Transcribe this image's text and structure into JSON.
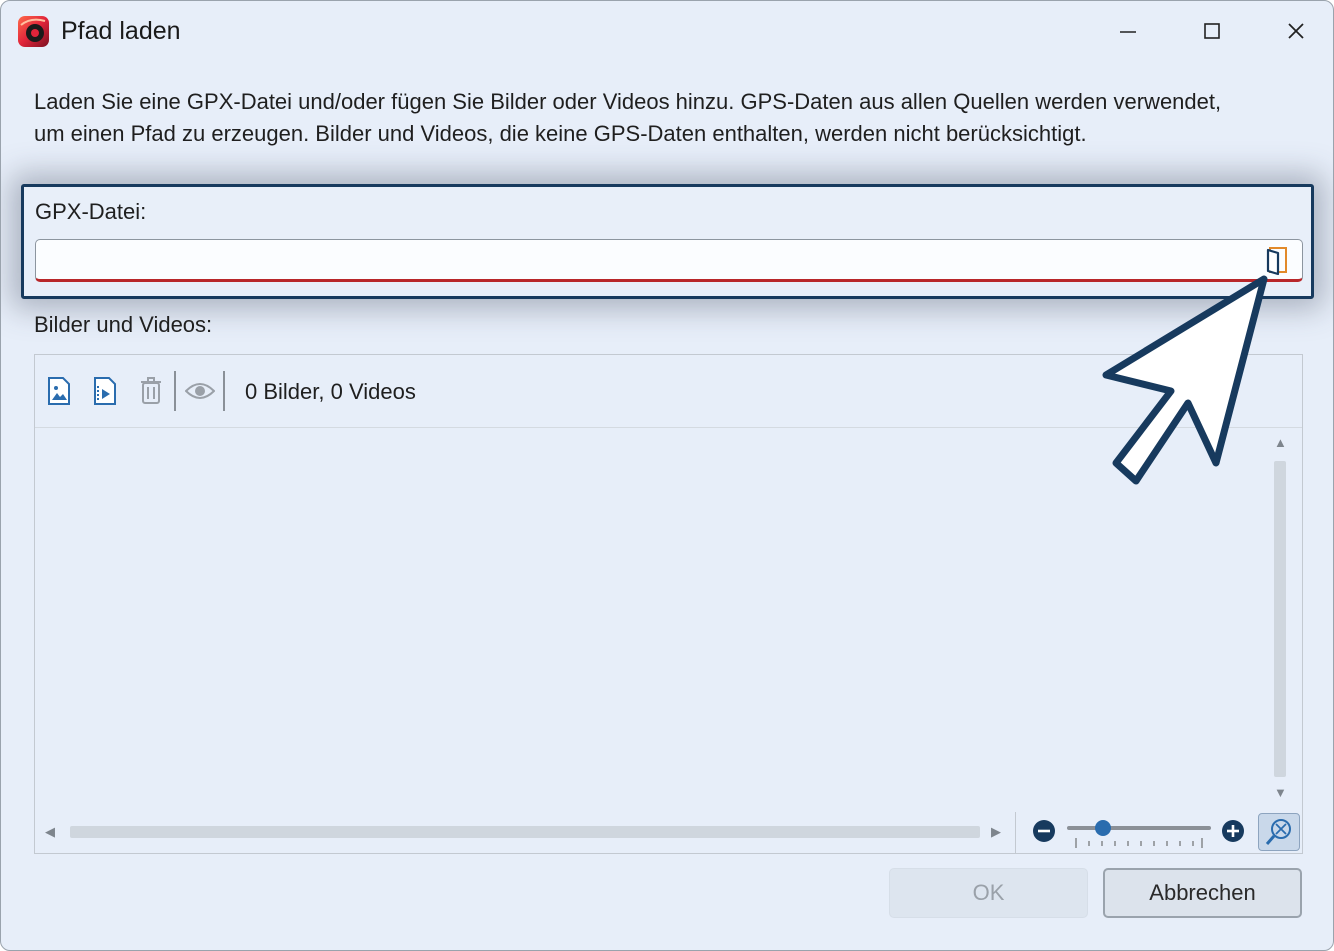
{
  "window": {
    "title": "Pfad laden"
  },
  "description": "Laden Sie eine GPX-Datei und/oder fügen Sie Bilder oder Videos hinzu. GPS-Daten aus allen Quellen werden verwendet, um einen Pfad zu erzeugen. Bilder und Videos, die keine GPS-Daten enthalten, werden nicht berücksichtigt.",
  "gpx": {
    "label": "GPX-Datei:",
    "value": "",
    "browse_icon": "folder-icon"
  },
  "media": {
    "label": "Bilder und Videos:",
    "toolbar": {
      "icons": [
        "add-image-icon",
        "add-video-icon",
        "trash-icon",
        "eye-icon"
      ],
      "count": "0 Bilder, 0 Videos"
    },
    "zoom_level": 0.25
  },
  "buttons": {
    "ok": "OK",
    "cancel": "Abbrechen"
  },
  "colors": {
    "accent": "#2a6cae",
    "highlight_border": "#173a5e",
    "input_error": "#b8272a"
  }
}
